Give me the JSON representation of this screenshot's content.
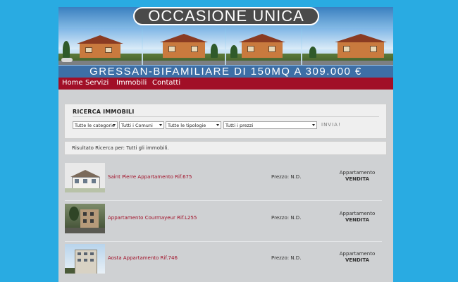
{
  "banner": {
    "title": "OCCASIONE UNICA",
    "subtitle": "GRESSAN-BIFAMILIARE DI 150MQ A 309.000 €"
  },
  "nav": {
    "items": [
      {
        "label": "Home"
      },
      {
        "label": "Servizi"
      },
      {
        "label": "Immobili"
      },
      {
        "label": "Contatti"
      }
    ]
  },
  "search": {
    "title": "RICERCA IMMOBILI",
    "selects": [
      {
        "value": "Tutte le categorie"
      },
      {
        "value": "Tutti i Comuni"
      },
      {
        "value": "Tutte le tipologie"
      },
      {
        "value": "Tutti i prezzi"
      }
    ],
    "submit_label": "INVIA!"
  },
  "results": {
    "summary": "Risultato Ricerca per: Tutti gli immobili.",
    "listings": [
      {
        "title": "Saint Pierre Appartamento Rif.675",
        "price": "Prezzo: N.D.",
        "type": "Appartamento",
        "contract": "VENDITA"
      },
      {
        "title": "Appartamento Courmayeur Rif.L255",
        "price": "Prezzo: N.D.",
        "type": "Appartamento",
        "contract": "VENDITA"
      },
      {
        "title": "Aosta Appartamento Rif.746",
        "price": "Prezzo: N.D.",
        "type": "Appartamento",
        "contract": "VENDITA"
      }
    ]
  },
  "colors": {
    "background": "#29abe2",
    "nav": "#a10f27",
    "link": "#a10f27",
    "content": "#cfd1d3"
  }
}
